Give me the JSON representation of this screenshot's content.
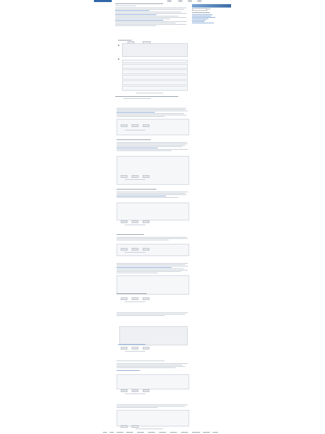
{
  "site": {
    "logo_text": "",
    "nav": [
      "",
      "",
      ""
    ]
  },
  "thread": {
    "title": "",
    "subtitle": ""
  },
  "sidebar": {
    "heading": "",
    "search_placeholder": "",
    "go_label": ""
  },
  "posts": [
    {
      "author": "",
      "body": ""
    },
    {
      "author": "",
      "body": ""
    },
    {
      "author": "",
      "body": ""
    },
    {
      "author": "",
      "body": ""
    },
    {
      "author": "",
      "body": ""
    },
    {
      "author": "",
      "body": ""
    },
    {
      "author": "",
      "body": ""
    },
    {
      "author": "",
      "body": ""
    },
    {
      "author": "",
      "body": ""
    }
  ],
  "footer": {
    "links": [
      "",
      "",
      "",
      "",
      "",
      "",
      "",
      "",
      "",
      "",
      "",
      "",
      ""
    ]
  },
  "colors": {
    "accent": "#2f66a8",
    "banner_start": "#7aa6d3",
    "banner_end": "#3b6ea5",
    "rule": "#c9cfd7"
  }
}
